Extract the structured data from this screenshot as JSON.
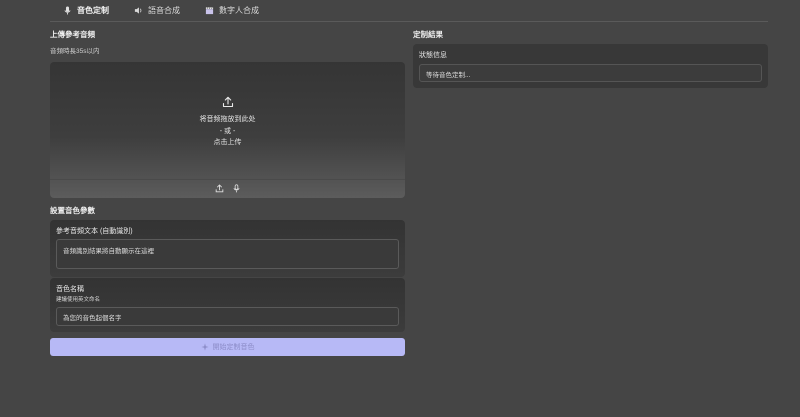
{
  "tabs": [
    {
      "label": "音色定制",
      "icon": "microphone-icon",
      "active": true
    },
    {
      "label": "語音合成",
      "icon": "speaker-icon",
      "active": false
    },
    {
      "label": "數字人合成",
      "icon": "clapperboard-icon",
      "active": false
    }
  ],
  "upload": {
    "title": "上傳參考音頻",
    "hint": "音頻時長35s以内",
    "drop_text": "将音频拖放到此处",
    "or_text": "- 或 -",
    "click_text": "点击上传"
  },
  "params": {
    "title": "設置音色參數",
    "ref_text_label": "參考音頻文本 (自動識別)",
    "ref_text_placeholder": "音頻識別結果將自動顯示在這裡",
    "name_label": "音色名稱",
    "name_sub": "建議使用英文命名",
    "name_placeholder": "為您的音色起個名字"
  },
  "submit": {
    "label": "開始定制音色",
    "color": "#b7b9f6"
  },
  "result": {
    "title": "定制結果",
    "status_label": "狀態信息",
    "status_value": "等待音色定制..."
  }
}
